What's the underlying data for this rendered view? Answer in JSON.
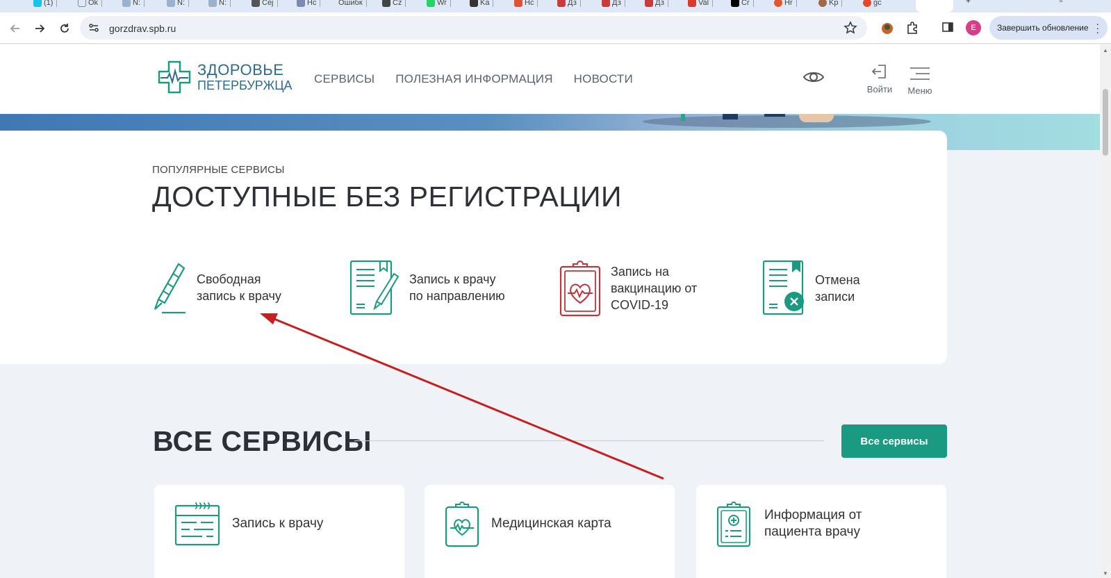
{
  "browser": {
    "url": "gorzdrav.spb.ru",
    "profile_initial": "E",
    "update_label": "Завершить обновление",
    "tabs": [
      "(1)",
      "Ok",
      "N:",
      "N:",
      "N:",
      "Cej",
      "Hc",
      "Ошибк",
      "Cz",
      "Wr",
      "Ka",
      "Hc",
      "Дз",
      "Дз",
      "Дз",
      "Val",
      "Cr",
      "Hr",
      "Kp",
      "gc"
    ]
  },
  "header": {
    "logo_line1": "ЗДОРОВЬЕ",
    "logo_line2": "ПЕТЕРБУРЖЦА",
    "nav": [
      "СЕРВИСЫ",
      "ПОЛЕЗНАЯ ИНФОРМАЦИЯ",
      "НОВОСТИ"
    ],
    "login_label": "Войти",
    "menu_label": "Меню"
  },
  "popular": {
    "eyebrow": "ПОПУЛЯРНЫЕ СЕРВИСЫ",
    "heading": "ДОСТУПНЫЕ БЕЗ РЕГИСТРАЦИИ",
    "services": [
      {
        "line1": "Свободная",
        "line2": "запись к врачу",
        "icon": "pen-icon"
      },
      {
        "line1": "Запись к врачу",
        "line2": "по направлению",
        "icon": "referral-document-icon"
      },
      {
        "line1": "Запись на",
        "line2": "вакцинацию от",
        "line3": "COVID-19",
        "icon": "clipboard-heart-icon"
      },
      {
        "line1": "Отмена",
        "line2": "записи",
        "icon": "cancel-document-icon"
      }
    ]
  },
  "all_services": {
    "title": "ВСЕ СЕРВИСЫ",
    "button": "Все сервисы",
    "cards": [
      {
        "line1": "Запись к врачу",
        "icon": "appointment-icon"
      },
      {
        "line1": "Медицинская карта",
        "icon": "medical-card-icon"
      },
      {
        "line1": "Информация от",
        "line2": "пациента врачу",
        "icon": "patient-info-icon"
      }
    ]
  },
  "colors": {
    "accent": "#1a9a81",
    "brand_text": "#2f6a8f",
    "covid_icon": "#c0343a",
    "annotation_arrow": "#c81e1e"
  }
}
